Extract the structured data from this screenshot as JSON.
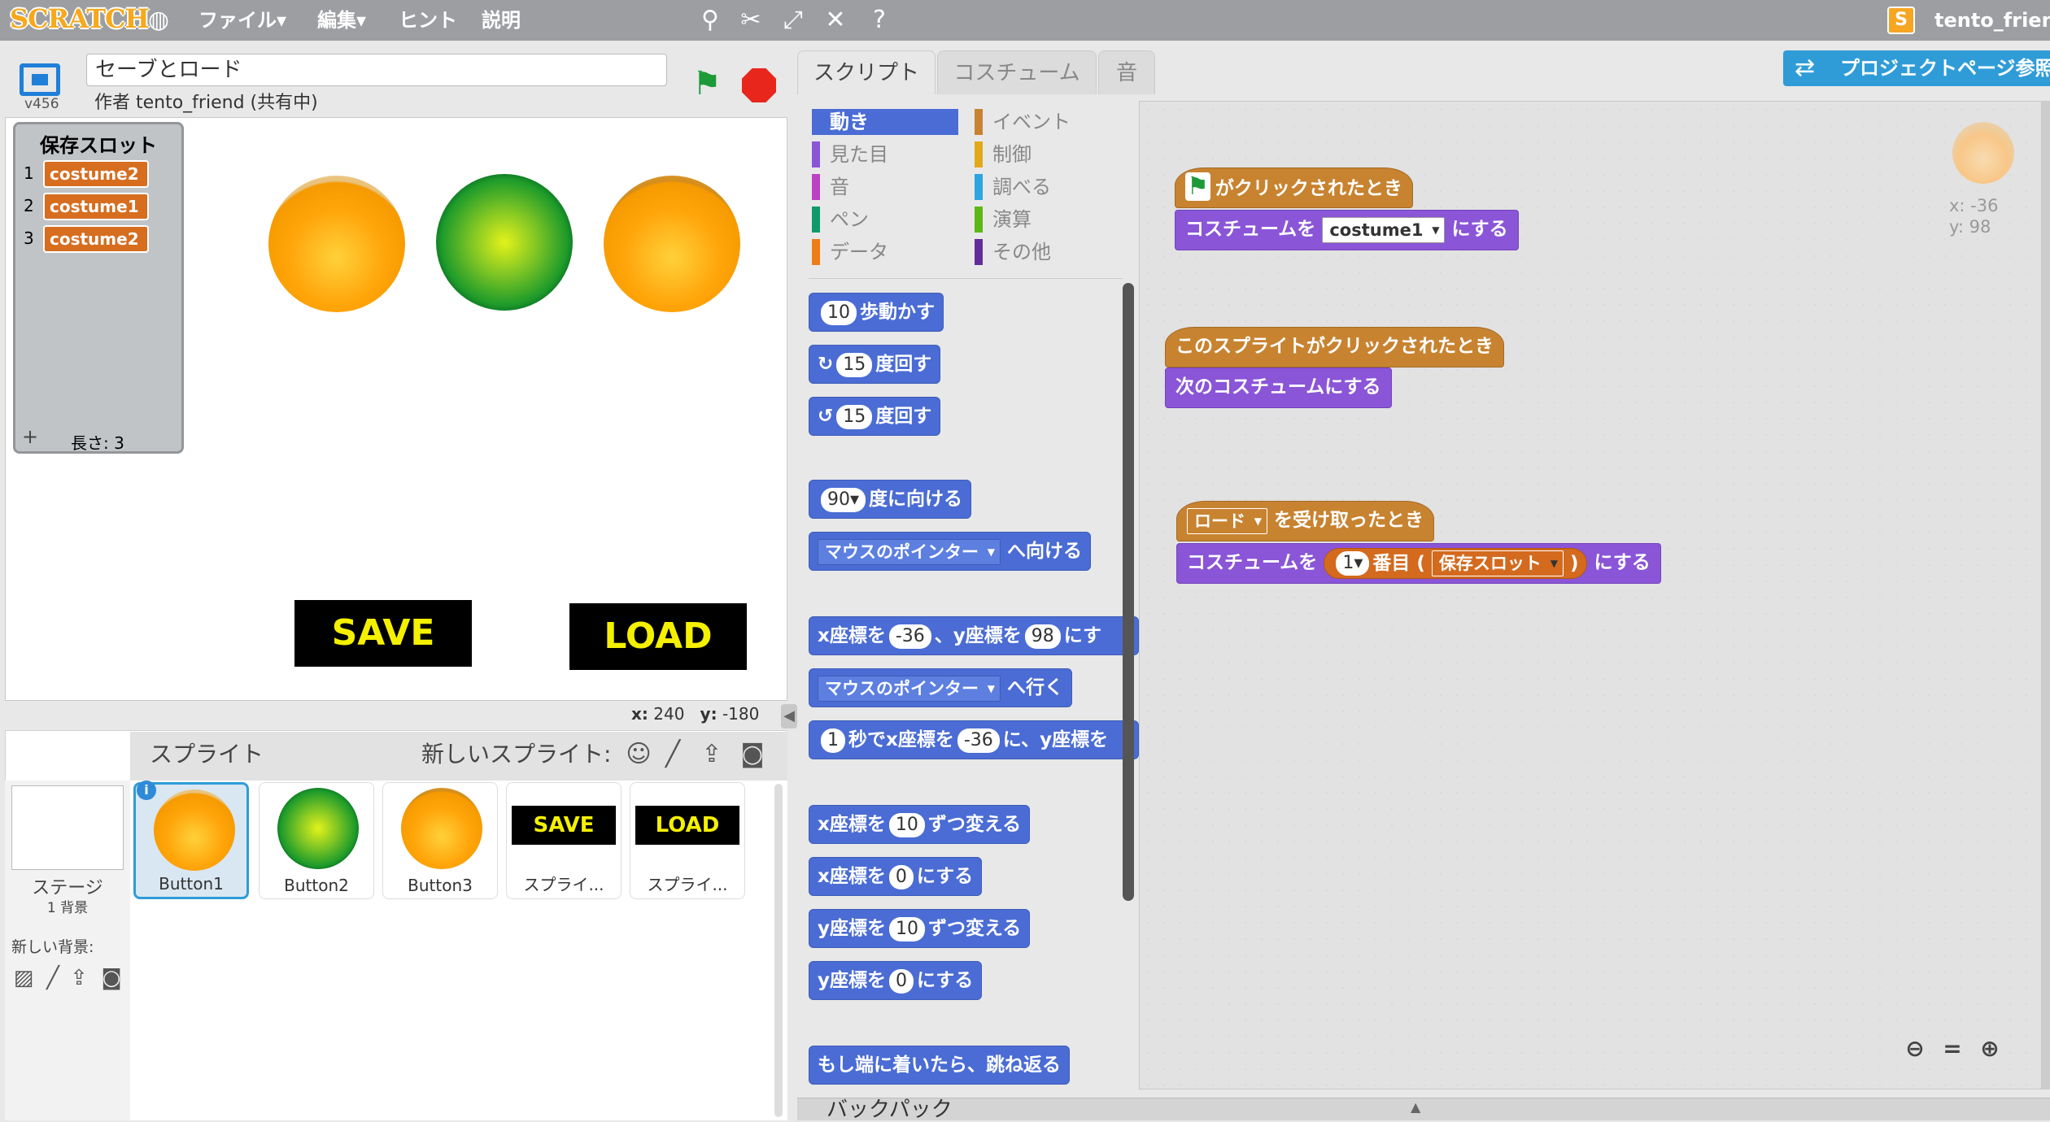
{
  "menubar": {
    "logo": "SCRATCH",
    "items": [
      "ファイル▾",
      "編集▾",
      "ヒント",
      "説明"
    ],
    "username": "tento_friend",
    "user_icon": "S"
  },
  "stage": {
    "version": "v456",
    "project_title": "セーブとロード",
    "author": "作者 tento_friend (共有中)",
    "mouse_x_label": "x:",
    "mouse_x": "240",
    "mouse_y_label": "y:",
    "mouse_y": "-180",
    "save_label": "SAVE",
    "load_label": "LOAD"
  },
  "list_monitor": {
    "title": "保存スロット",
    "items": [
      {
        "index": "1",
        "value": "costume2"
      },
      {
        "index": "2",
        "value": "costume1"
      },
      {
        "index": "3",
        "value": "costume2"
      }
    ],
    "plus": "+",
    "length_label": "長さ: 3"
  },
  "sprites": {
    "label": "スプライト",
    "new_sprite_label": "新しいスプライト:",
    "stage_label": "ステージ",
    "bg_count": "1 背景",
    "new_bg_label": "新しい背景:",
    "items": [
      {
        "name": "Button1"
      },
      {
        "name": "Button2"
      },
      {
        "name": "Button3"
      },
      {
        "name": "スプライ...",
        "text": "SAVE"
      },
      {
        "name": "スプライ...",
        "text": "LOAD"
      }
    ],
    "info_badge": "i"
  },
  "tabs": [
    "スクリプト",
    "コスチューム",
    "音"
  ],
  "categories": {
    "left": [
      {
        "label": "動き",
        "color": "#4a6cd4"
      },
      {
        "label": "見た目",
        "color": "#8a55d7"
      },
      {
        "label": "音",
        "color": "#bb42c3"
      },
      {
        "label": "ペン",
        "color": "#0e9a6c"
      },
      {
        "label": "データ",
        "color": "#ee7d16"
      }
    ],
    "right": [
      {
        "label": "イベント",
        "color": "#c88330"
      },
      {
        "label": "制御",
        "color": "#e1a91a"
      },
      {
        "label": "調べる",
        "color": "#2ca5e2"
      },
      {
        "label": "演算",
        "color": "#5cb712"
      },
      {
        "label": "その他",
        "color": "#632d99"
      }
    ]
  },
  "palette": {
    "move_steps": {
      "num": "10",
      "text": "歩動かす"
    },
    "turn_right": {
      "num": "15",
      "text": "度回す"
    },
    "turn_left": {
      "num": "15",
      "text": "度回す"
    },
    "point_dir": {
      "num": "90▾",
      "text": "度に向ける"
    },
    "point_towards": {
      "dd": "マウスのポインター",
      "text": "へ向ける"
    },
    "goto_xy": {
      "a": "x座標を",
      "x": "-36",
      "b": "、y座標を",
      "y": "98",
      "c": "にす"
    },
    "goto": {
      "dd": "マウスのポインター",
      "text": "へ行く"
    },
    "glide": {
      "n": "1",
      "a": "秒でx座標を",
      "x": "-36",
      "b": "に、y座標を"
    },
    "change_x": {
      "a": "x座標を",
      "n": "10",
      "b": "ずつ変える"
    },
    "set_x": {
      "a": "x座標を",
      "n": "0",
      "b": "にする"
    },
    "change_y": {
      "a": "y座標を",
      "n": "10",
      "b": "ずつ変える"
    },
    "set_y": {
      "a": "y座標を",
      "n": "0",
      "b": "にする"
    },
    "bounce": "もし端に着いたら、跳ね返る"
  },
  "scripts": {
    "project_page": "プロジェクトページ参照",
    "sprite_x": "x: -36",
    "sprite_y": "y: 98",
    "s1_hat": "がクリックされたとき",
    "s1_a": "コスチュームを",
    "s1_dd": "costume1",
    "s1_b": "にする",
    "s2_hat": "このスプライトがクリックされたとき",
    "s2_a": "次のコスチュームにする",
    "s3_dd": "ロード",
    "s3_hat": "を受け取ったとき",
    "s3_a": "コスチュームを",
    "s3_n": "1▾",
    "s3_b": "番目",
    "s3_open": "(",
    "s3_list": "保存スロット",
    "s3_close": ")",
    "s3_c": "にする"
  },
  "backpack": "バックパック"
}
